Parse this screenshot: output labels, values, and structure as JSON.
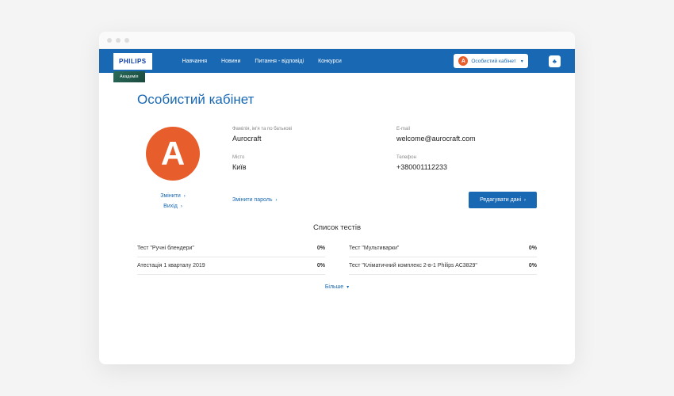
{
  "brand": {
    "logo": "PHILIPS",
    "sub": "Академія"
  },
  "nav": {
    "training": "Навчання",
    "news": "Новини",
    "faq": "Питання - відповіді",
    "contests": "Конкурси"
  },
  "header": {
    "cabinet_label": "Особистий кабінет",
    "avatar_letter": "А"
  },
  "page": {
    "title": "Особистий кабінет"
  },
  "profile": {
    "avatar_letter": "А",
    "change_link": "Змінити",
    "logout_link": "Вихід",
    "fields": {
      "name_label": "Фамілія, ім'я та по батькові",
      "name_value": "Aurocraft",
      "email_label": "E-mail",
      "email_value": "welcome@aurocraft.com",
      "city_label": "Місто",
      "city_value": "Київ",
      "phone_label": "Телефон",
      "phone_value": "+380001112233"
    },
    "change_password": "Змінити пароль",
    "edit_button": "Редагувати дані"
  },
  "tests": {
    "title": "Список тестів",
    "items": [
      {
        "name": "Тест \"Ручні блендери\"",
        "score": "0%"
      },
      {
        "name": "Тест \"Мультиварки\"",
        "score": "0%"
      },
      {
        "name": "Атестація 1 кварталу 2019",
        "score": "0%"
      },
      {
        "name": "Тест \"Кліматичний комплекс 2-в-1 Philips AC3829\"",
        "score": "0%"
      }
    ],
    "more": "Більше"
  }
}
